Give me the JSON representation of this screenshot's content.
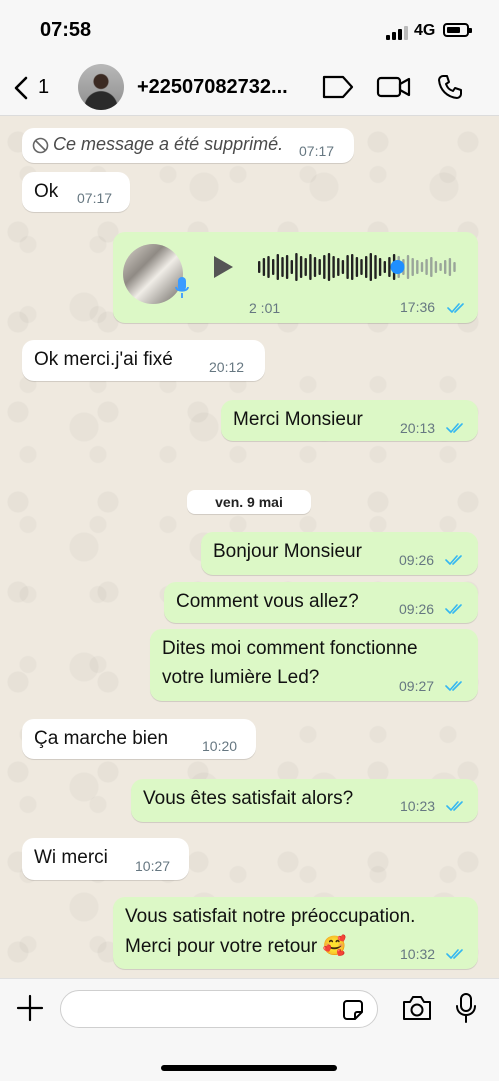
{
  "status_bar": {
    "time": "07:58",
    "network": "4G"
  },
  "header": {
    "back_count": "1",
    "contact_name": "+22507082732..."
  },
  "date_separator": "ven. 9 mai",
  "messages": [
    {
      "text": "Ce message a été supprimé.",
      "time": "07:17"
    },
    {
      "text": "Ok",
      "time": "07:17"
    },
    {
      "duration": "2 :01",
      "time": "17:36"
    },
    {
      "text": "Ok merci.j'ai fixé",
      "time": "20:12"
    },
    {
      "text": "Merci Monsieur",
      "time": "20:13"
    },
    {
      "text": "Bonjour Monsieur",
      "time": "09:26"
    },
    {
      "text": "Comment vous allez?",
      "time": "09:26"
    },
    {
      "line1": "Dites moi comment fonctionne",
      "line2": "votre lumière Led?",
      "time": "09:27"
    },
    {
      "text": "Ça marche bien",
      "time": "10:20"
    },
    {
      "text": "Vous êtes satisfait alors?",
      "time": "10:23"
    },
    {
      "text": "Wi merci",
      "time": "10:27"
    },
    {
      "line1": "Vous satisfait notre préoccupation.",
      "line2": "Merci pour votre retour 🥰",
      "time": "10:32"
    }
  ],
  "colors": {
    "outgoing_bubble": "#dcf8c6",
    "incoming_bubble": "#ffffff",
    "read_ticks": "#34b7f1",
    "accent": "#1f8fff"
  },
  "voice_note": {
    "progress": 0.7
  }
}
